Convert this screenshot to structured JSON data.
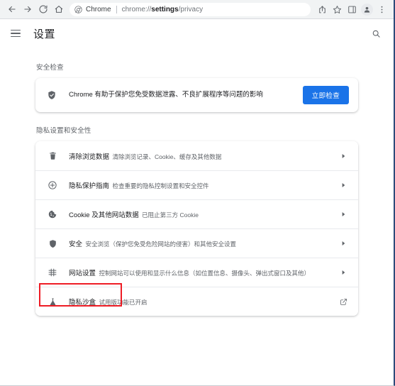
{
  "browser": {
    "nav": {
      "back": "back-arrow",
      "forward": "forward-arrow",
      "reload": "reload",
      "home": "home"
    },
    "omnibox": {
      "site_icon": "chrome-logo-icon",
      "site_label": "Chrome",
      "url_prefix": "chrome://",
      "url_bold": "settings",
      "url_suffix": "/privacy",
      "full_url": "chrome://settings/privacy"
    },
    "actions": [
      {
        "name": "share-icon",
        "label": "分享"
      },
      {
        "name": "bookmark-star-icon",
        "label": "收藏"
      },
      {
        "name": "side-panel-icon",
        "label": "侧边栏"
      },
      {
        "name": "profile-avatar-icon",
        "label": "个人资料"
      },
      {
        "name": "three-dot-menu-icon",
        "label": "更多"
      }
    ]
  },
  "settings": {
    "menu_icon": "hamburger-menu-icon",
    "title": "设置",
    "search_icon": "search-icon"
  },
  "safety_check": {
    "section_title": "安全检查",
    "icon": "shield-check-icon",
    "description": "Chrome 有助于保护您免受数据泄露、不良扩展程序等问题的影响",
    "button_label": "立即检查"
  },
  "privacy": {
    "section_title": "隐私设置和安全性",
    "rows": [
      {
        "icon": "trash-icon",
        "title": "清除浏览数据",
        "subtitle": "清除浏览记录、Cookie、缓存及其他数据",
        "end_icon": "chevron-right-icon"
      },
      {
        "icon": "privacy-guide-icon",
        "title": "隐私保护指南",
        "subtitle": "检查重要的隐私控制设置和安全控件",
        "end_icon": "chevron-right-icon"
      },
      {
        "icon": "cookie-icon",
        "title": "Cookie 及其他网站数据",
        "subtitle": "已阻止第三方 Cookie",
        "end_icon": "chevron-right-icon"
      },
      {
        "icon": "shield-icon",
        "title": "安全",
        "subtitle": "安全浏览（保护您免受危险网站的侵害）和其他安全设置",
        "end_icon": "chevron-right-icon"
      },
      {
        "icon": "sliders-icon",
        "title": "网站设置",
        "subtitle": "控制网站可以使用和显示什么信息（如位置信息、摄像头、弹出式窗口及其他）",
        "end_icon": "chevron-right-icon"
      },
      {
        "icon": "flask-icon",
        "title": "隐私沙盒",
        "subtitle": "试用版功能已开启",
        "end_icon": "external-link-icon"
      }
    ]
  },
  "annotation": {
    "highlight_color": "#ee1c25",
    "target": "网站设置"
  },
  "colors": {
    "accent": "#1a73e8",
    "text_primary": "#202124",
    "text_secondary": "#5f6368",
    "toolbar_bg": "#f1f3f4",
    "divider": "#e8eaed"
  }
}
